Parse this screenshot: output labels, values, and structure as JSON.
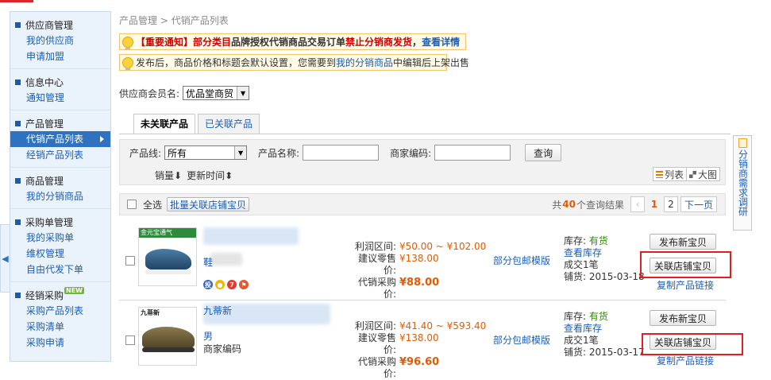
{
  "sidebar": {
    "sections": [
      {
        "title": "供应商管理",
        "items": [
          {
            "label": "我的供应商"
          },
          {
            "label": "申请加盟"
          }
        ]
      },
      {
        "title": "信息中心",
        "items": [
          {
            "label": "通知管理"
          }
        ]
      },
      {
        "title": "产品管理",
        "items": [
          {
            "label": "代销产品列表",
            "active": true
          },
          {
            "label": "经销产品列表"
          }
        ]
      },
      {
        "title": "商品管理",
        "items": [
          {
            "label": "我的分销商品"
          }
        ]
      },
      {
        "title": "采购单管理",
        "items": [
          {
            "label": "我的采购单"
          },
          {
            "label": "维权管理"
          },
          {
            "label": "自由代发下单"
          }
        ]
      },
      {
        "title": "经销采购",
        "badge": "NEW",
        "items": [
          {
            "label": "采购产品列表"
          },
          {
            "label": "采购清单"
          },
          {
            "label": "采购申请"
          }
        ]
      }
    ]
  },
  "breadcrumb": {
    "root": "产品管理",
    "sep": ">",
    "current": "代销产品列表"
  },
  "notice1": {
    "p1": "【重要通知】部分类目",
    "p2": "品牌授权代销商品交易订单",
    "p3": "禁止分销商发货",
    "p4": "，",
    "link": "查看详情"
  },
  "notice2": {
    "p1": "发布后，商品价格和标题会默认设置，您需要到",
    "link": "我的分销商品",
    "p2": "中编辑后上架出售"
  },
  "member": {
    "label": "供应商会员名:",
    "value": "优品堂商贸"
  },
  "tabs": [
    {
      "label": "未关联产品",
      "active": true
    },
    {
      "label": "已关联产品"
    }
  ],
  "filter": {
    "line_label": "产品线:",
    "line_value": "所有",
    "name_label": "产品名称:",
    "code_label": "商家编码:",
    "search_button": "查询",
    "sort_sales": "销量⬇",
    "sort_updated": "更新时间⬍",
    "view_list": "列表",
    "view_grid": "大图"
  },
  "bulk": {
    "select_all": "全选",
    "bulk_link": "批量关联店铺宝贝",
    "total_prefix": "共",
    "total_count": "40",
    "total_suffix": "个查询结果",
    "pages": [
      "1",
      "2"
    ],
    "next": "下一页"
  },
  "products": [
    {
      "thumb_brand": "金元宝通气",
      "name_line1": "鞋",
      "profit_label": "利润区间:",
      "profit_value": "¥50.00 ~ ¥102.00",
      "retail_label": "建议零售价:",
      "retail_value": "¥138.00",
      "purchase_label": "代销采购价:",
      "purchase_value": "¥88.00",
      "shipping": "部分包邮模版",
      "stock_label": "库存:",
      "stock_value": "有货",
      "view_stock": "查看库存",
      "deals": "成交1笔",
      "listed_label": "铺货:",
      "listed_date": "2015-03-18",
      "publish_button": "发布新宝贝",
      "link_button": "关联店铺宝贝",
      "copy_link": "复制产品链接"
    },
    {
      "thumb_brand": "九蒂新",
      "name_line1": "九蒂新",
      "name_line2": "男",
      "name_line3": "商家编码",
      "profit_label": "利润区间:",
      "profit_value": "¥41.40 ~ ¥593.40",
      "retail_label": "建议零售价:",
      "retail_value": "¥138.00",
      "purchase_label": "代销采购价:",
      "purchase_value": "¥96.60",
      "shipping": "部分包邮模版",
      "stock_label": "库存:",
      "stock_value": "有货",
      "view_stock": "查看库存",
      "deals": "成交1笔",
      "listed_label": "铺货:",
      "listed_date": "2015-03-17",
      "publish_button": "发布新宝贝",
      "link_button": "关联店铺宝贝",
      "copy_link": "复制产品链接"
    }
  ],
  "right_tab": {
    "label": "分销商需求调研"
  },
  "colors": {
    "accent": "#2f73c0",
    "price": "#e65a00",
    "highlight_box": "#e02020",
    "stock_ok": "#2a8a00"
  }
}
